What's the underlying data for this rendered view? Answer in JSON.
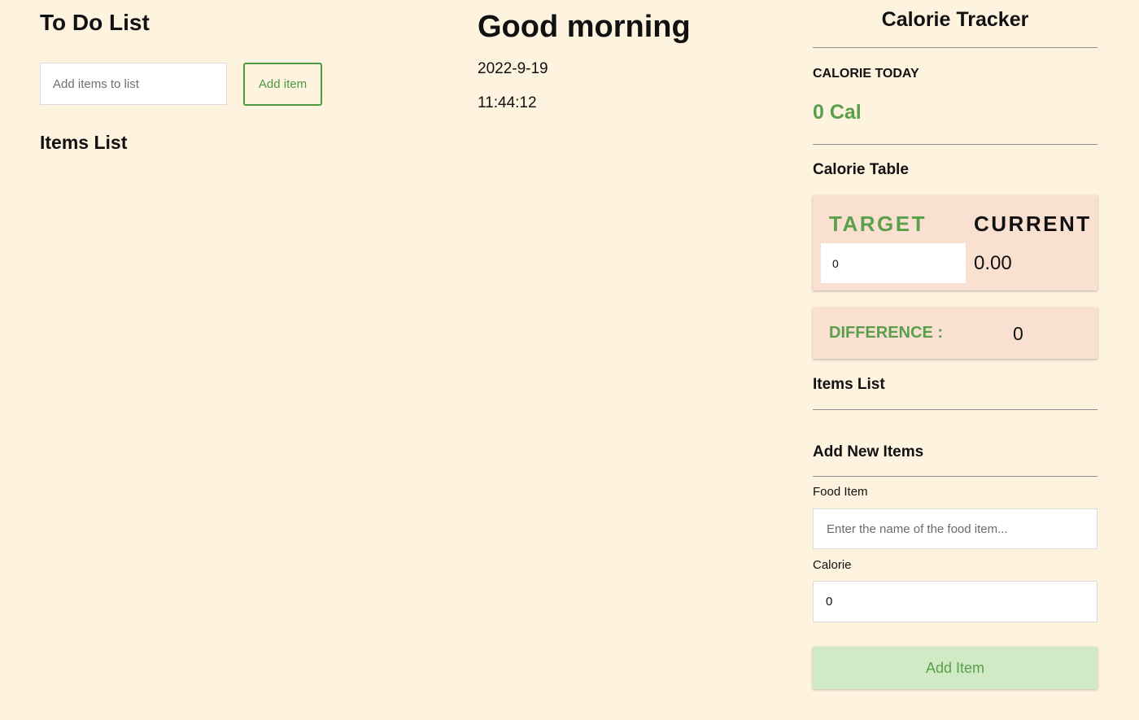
{
  "todo": {
    "title": "To Do List",
    "input_placeholder": "Add items to list",
    "add_button_label": "Add item",
    "items_list_title": "Items List"
  },
  "greeting": {
    "message": "Good morning",
    "date": "2022-9-19",
    "time": "11:44:12"
  },
  "calorie_tracker": {
    "title": "Calorie Tracker",
    "calorie_today_label": "CALORIE TODAY",
    "calorie_today_value": "0 Cal",
    "table_title": "Calorie Table",
    "target_label": "TARGET",
    "current_label": "CURRENT",
    "target_value": "0",
    "current_value": "0.00",
    "difference_label": "DIFFERENCE :",
    "difference_value": "0",
    "items_list_title": "Items List",
    "add_new_title": "Add New Items",
    "food_item_label": "Food Item",
    "food_item_placeholder": "Enter the name of the food item...",
    "calorie_label": "Calorie",
    "calorie_value": "0",
    "add_item_button_label": "Add Item"
  },
  "colors": {
    "background": "#fdf3df",
    "accent_green": "#5aa04c",
    "card_background": "#f9e0d1",
    "button_green_bg": "#d0eac6"
  }
}
